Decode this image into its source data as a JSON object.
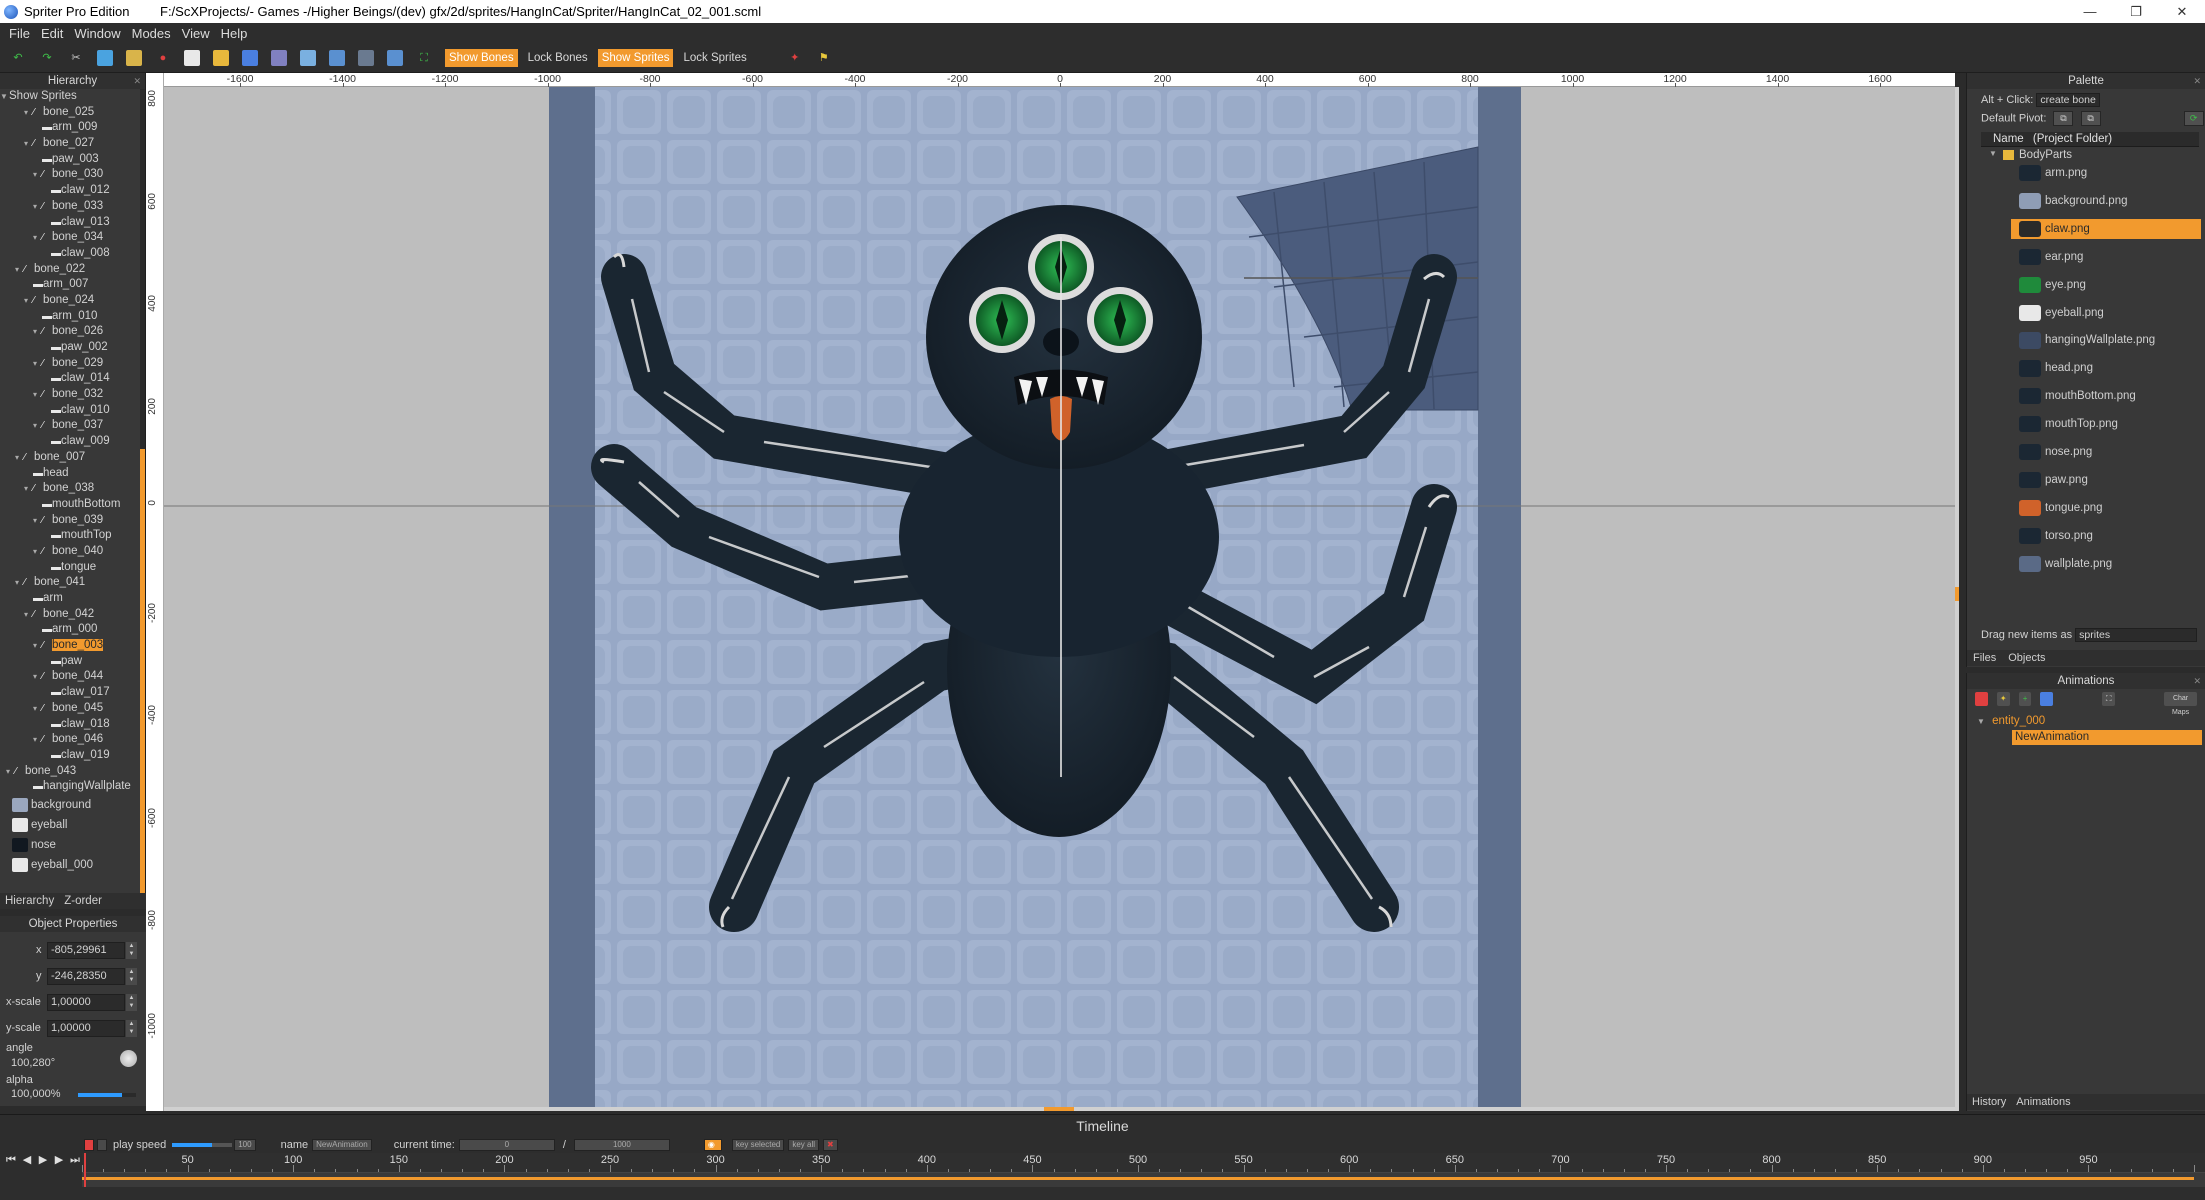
{
  "window": {
    "app_name": "Spriter Pro Edition",
    "path": "F:/ScXProjects/- Games -/Higher Beings/(dev) gfx/2d/sprites/HangInCat/Spriter/HangInCat_02_001.scml",
    "minimize": "—",
    "maximize": "❐",
    "close": "✕"
  },
  "menu": [
    "File",
    "Edit",
    "Window",
    "Modes",
    "View",
    "Help"
  ],
  "toolbar": {
    "show_bones": "Show Bones",
    "lock_bones": "Lock Bones",
    "show_sprites": "Show Sprites",
    "lock_sprites": "Lock Sprites"
  },
  "hierarchy": {
    "title": "Hierarchy",
    "show_sprites": "Show Sprites",
    "items": [
      {
        "label": "bone_025",
        "indent": 2,
        "type": "bone",
        "expanded": true
      },
      {
        "label": "arm_009",
        "indent": 3,
        "type": "sprite"
      },
      {
        "label": "bone_027",
        "indent": 2,
        "type": "bone",
        "expanded": true
      },
      {
        "label": "paw_003",
        "indent": 3,
        "type": "sprite"
      },
      {
        "label": "bone_030",
        "indent": 3,
        "type": "bone",
        "expanded": true
      },
      {
        "label": "claw_012",
        "indent": 4,
        "type": "sprite"
      },
      {
        "label": "bone_033",
        "indent": 3,
        "type": "bone",
        "expanded": true
      },
      {
        "label": "claw_013",
        "indent": 4,
        "type": "sprite"
      },
      {
        "label": "bone_034",
        "indent": 3,
        "type": "bone",
        "expanded": true
      },
      {
        "label": "claw_008",
        "indent": 4,
        "type": "sprite"
      },
      {
        "label": "bone_022",
        "indent": 1,
        "type": "bone",
        "expanded": true
      },
      {
        "label": "arm_007",
        "indent": 2,
        "type": "sprite"
      },
      {
        "label": "bone_024",
        "indent": 2,
        "type": "bone",
        "expanded": true
      },
      {
        "label": "arm_010",
        "indent": 3,
        "type": "sprite"
      },
      {
        "label": "bone_026",
        "indent": 3,
        "type": "bone",
        "expanded": true
      },
      {
        "label": "paw_002",
        "indent": 4,
        "type": "sprite"
      },
      {
        "label": "bone_029",
        "indent": 3,
        "type": "bone",
        "expanded": true
      },
      {
        "label": "claw_014",
        "indent": 4,
        "type": "sprite"
      },
      {
        "label": "bone_032",
        "indent": 3,
        "type": "bone",
        "expanded": true
      },
      {
        "label": "claw_010",
        "indent": 4,
        "type": "sprite"
      },
      {
        "label": "bone_037",
        "indent": 3,
        "type": "bone",
        "expanded": true
      },
      {
        "label": "claw_009",
        "indent": 4,
        "type": "sprite"
      },
      {
        "label": "bone_007",
        "indent": 1,
        "type": "bone",
        "expanded": true
      },
      {
        "label": "head",
        "indent": 2,
        "type": "sprite"
      },
      {
        "label": "bone_038",
        "indent": 2,
        "type": "bone",
        "expanded": true
      },
      {
        "label": "mouthBottom",
        "indent": 3,
        "type": "sprite"
      },
      {
        "label": "bone_039",
        "indent": 3,
        "type": "bone",
        "expanded": true
      },
      {
        "label": "mouthTop",
        "indent": 4,
        "type": "sprite"
      },
      {
        "label": "bone_040",
        "indent": 3,
        "type": "bone",
        "expanded": true
      },
      {
        "label": "tongue",
        "indent": 4,
        "type": "sprite"
      },
      {
        "label": "bone_041",
        "indent": 1,
        "type": "bone",
        "expanded": true
      },
      {
        "label": "arm",
        "indent": 2,
        "type": "sprite"
      },
      {
        "label": "bone_042",
        "indent": 2,
        "type": "bone",
        "expanded": true
      },
      {
        "label": "arm_000",
        "indent": 3,
        "type": "sprite"
      },
      {
        "label": "bone_003",
        "indent": 3,
        "type": "bone",
        "expanded": true,
        "selected": true
      },
      {
        "label": "paw",
        "indent": 4,
        "type": "sprite"
      },
      {
        "label": "bone_044",
        "indent": 3,
        "type": "bone",
        "expanded": true
      },
      {
        "label": "claw_017",
        "indent": 4,
        "type": "sprite"
      },
      {
        "label": "bone_045",
        "indent": 3,
        "type": "bone",
        "expanded": true
      },
      {
        "label": "claw_018",
        "indent": 4,
        "type": "sprite"
      },
      {
        "label": "bone_046",
        "indent": 3,
        "type": "bone",
        "expanded": true
      },
      {
        "label": "claw_019",
        "indent": 4,
        "type": "sprite"
      },
      {
        "label": "bone_043",
        "indent": 0,
        "type": "bone",
        "expanded": true
      },
      {
        "label": "hangingWallplate",
        "indent": 2,
        "type": "sprite"
      }
    ],
    "root_sprites": [
      {
        "label": "background",
        "thumb": "#9aa7be"
      },
      {
        "label": "eyeball",
        "thumb": "#e8e8e8"
      },
      {
        "label": "nose",
        "thumb": "#111820"
      },
      {
        "label": "eyeball_000",
        "thumb": "#e8e8e8"
      }
    ],
    "tabs": [
      "Hierarchy",
      "Z-order"
    ]
  },
  "object_properties": {
    "title": "Object Properties",
    "x_label": "x",
    "x_value": "-805,29961",
    "y_label": "y",
    "y_value": "-246,28350",
    "xscale_label": "x-scale",
    "xscale_value": "1,00000",
    "yscale_label": "y-scale",
    "yscale_value": "1,00000",
    "angle_label": "angle",
    "angle_value": "100,280°",
    "alpha_label": "alpha",
    "alpha_value": "100,000%",
    "alpha_fraction": 1.0
  },
  "ruler": {
    "h_labels": [
      "-1600",
      "-1400",
      "-1200",
      "-1000",
      "-800",
      "-600",
      "-400",
      "-200",
      "0",
      "200",
      "400",
      "600",
      "800",
      "1000",
      "1200",
      "1400",
      "1600"
    ],
    "v_labels": [
      "800",
      "600",
      "400",
      "200",
      "0",
      "-200",
      "-400",
      "-600",
      "-800",
      "-1000"
    ]
  },
  "palette": {
    "title": "Palette",
    "alt_click": "Alt + Click:",
    "create_bone": "create bone",
    "default_pivot": "Default Pivot:",
    "name_col": "Name",
    "project_folder": "(Project Folder)",
    "folder": "BodyParts",
    "files": [
      {
        "name": "arm.png",
        "thumb": "#1b2733"
      },
      {
        "name": "background.png",
        "thumb": "#8f9db5"
      },
      {
        "name": "claw.png",
        "thumb": "#2a2a2a",
        "selected": true
      },
      {
        "name": "ear.png",
        "thumb": "#1b2733"
      },
      {
        "name": "eye.png",
        "thumb": "#1f8a3b"
      },
      {
        "name": "eyeball.png",
        "thumb": "#e8e8e8"
      },
      {
        "name": "hangingWallplate.png",
        "thumb": "#3c4a63"
      },
      {
        "name": "head.png",
        "thumb": "#1b2733"
      },
      {
        "name": "mouthBottom.png",
        "thumb": "#1b2733"
      },
      {
        "name": "mouthTop.png",
        "thumb": "#1b2733"
      },
      {
        "name": "nose.png",
        "thumb": "#1b2733"
      },
      {
        "name": "paw.png",
        "thumb": "#1b2733"
      },
      {
        "name": "tongue.png",
        "thumb": "#d0622a"
      },
      {
        "name": "torso.png",
        "thumb": "#1b2733"
      },
      {
        "name": "wallplate.png",
        "thumb": "#5a6a86"
      }
    ],
    "drag_label": "Drag new items as",
    "drag_value": "sprites",
    "tabs": [
      "Files",
      "Objects"
    ]
  },
  "animations": {
    "title": "Animations",
    "char_maps": "Char Maps",
    "entity": "entity_000",
    "animation": "NewAnimation",
    "tabs": [
      "History",
      "Animations"
    ]
  },
  "timeline": {
    "title": "Timeline",
    "play_speed": "play speed",
    "play_speed_value": "100",
    "name_label": "name",
    "name_value": "NewAnimation",
    "current_time": "current time:",
    "time_value": "0",
    "slash": "/",
    "length_value": "1000",
    "key_selected": "key selected",
    "key_all": "key all",
    "labels": [
      "50",
      "100",
      "150",
      "200",
      "250",
      "300",
      "350",
      "400",
      "450",
      "500",
      "550",
      "600",
      "650",
      "700",
      "750",
      "800",
      "850",
      "900",
      "950"
    ],
    "end": 1000
  },
  "colors": {
    "accent": "#f29a2e",
    "panel": "#383838",
    "canvas_bg": "#bebebe",
    "wall": "#95a6c4",
    "creature": "#16212c",
    "eye": "#1f8a3b"
  }
}
